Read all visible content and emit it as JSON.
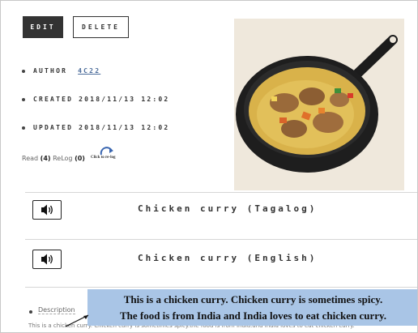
{
  "actions": {
    "edit_label": "EDIT",
    "delete_label": "DELETE"
  },
  "meta": {
    "author_label": "AUTHOR",
    "author_value": "4C22",
    "created_label": "CREATED",
    "created_value": "2018/11/13 12:02",
    "updated_label": "UPDATED",
    "updated_value": "2018/11/13 12:02"
  },
  "stats": {
    "read_label": "Read",
    "read_count": "(4)",
    "relog_label": "ReLog",
    "relog_count": "(0)",
    "relog_link": "Click to re-log"
  },
  "audio": [
    {
      "title": "Chicken curry (Tagalog)",
      "icon": "speaker-icon"
    },
    {
      "title": "Chicken curry (English)",
      "icon": "speaker-icon"
    }
  ],
  "description": {
    "label": "Description",
    "text": "This is a chicken curry. Chicken curry is sometimes spicy.the food is from India.and India loves to eat chicken curry."
  },
  "callout": {
    "line1": "This is a chicken curry. Chicken curry is sometimes spicy.",
    "line2": "The food is from India and India loves to eat chicken curry."
  },
  "colors": {
    "callout_bg": "#a9c5e6",
    "primary_button": "#333333",
    "link": "#4a6b9a"
  }
}
